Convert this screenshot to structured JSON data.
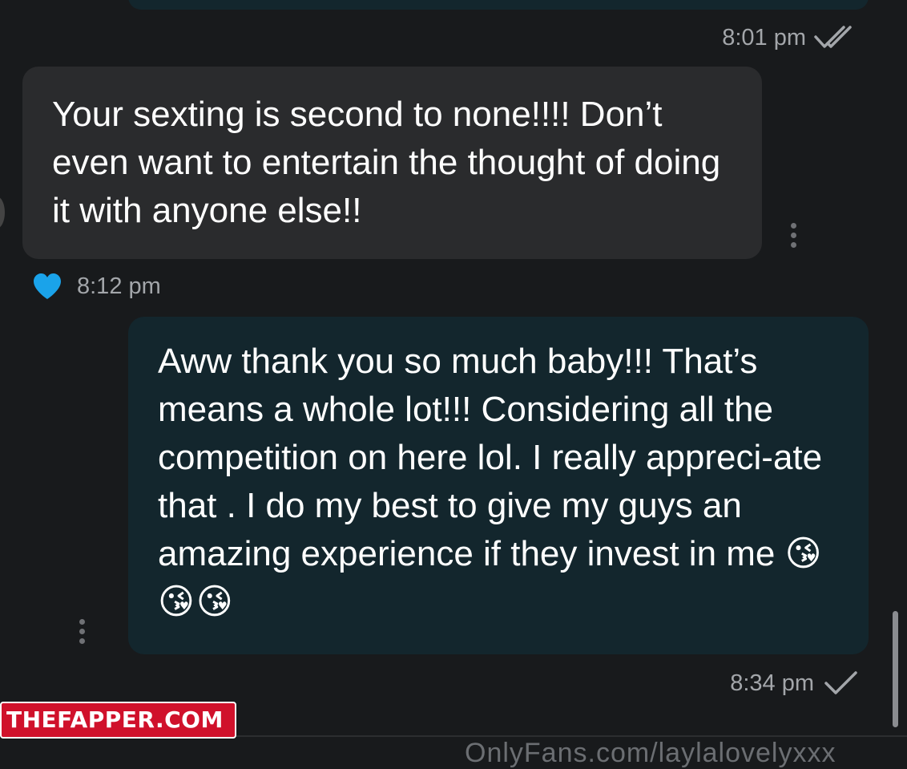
{
  "messages": [
    {
      "direction": "outgoing",
      "time": "8:01 pm",
      "status": "read"
    },
    {
      "direction": "incoming",
      "text": "Your sexting is second to none!!!! Don’t even want to entertain the thought of doing it with anyone else!!",
      "time": "8:12 pm",
      "reaction": "heart"
    },
    {
      "direction": "outgoing",
      "text": "Aww thank you so much baby!!! That’s means a whole lot!!! Considering all the competition on here lol. I really appreci-ate that . I do my best to give my guys an amazing experience if they invest in me",
      "emoji": "😘😘😘",
      "time": "8:34 pm",
      "status": "sent"
    }
  ],
  "watermark": "THEFAPPER.COM",
  "footer_url": "OnlyFans.com/laylalovelyxxx",
  "colors": {
    "background": "#181a1c",
    "incoming_bubble": "#2a2b2d",
    "outgoing_bubble": "#13262d",
    "heart": "#1aa3ea",
    "watermark_bg": "#d0112b"
  }
}
